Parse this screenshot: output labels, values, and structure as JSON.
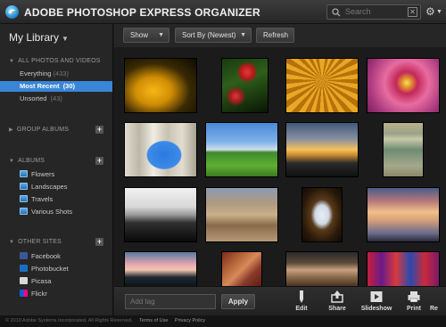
{
  "app": {
    "title": "ADOBE PHOTOSHOP EXPRESS ORGANIZER"
  },
  "search": {
    "placeholder": "Search"
  },
  "sidebar": {
    "title": "My Library",
    "section_all": "ALL PHOTOS AND VIDEOS",
    "items": [
      {
        "label": "Everything",
        "count": "(433)"
      },
      {
        "label": "Most Recent",
        "count": "(30)"
      },
      {
        "label": "Unsorted",
        "count": "(43)"
      }
    ],
    "section_group": "GROUP ALBUMS",
    "section_albums": "ALBUMS",
    "albums": [
      "Flowers",
      "Landscapes",
      "Travels",
      "Various Shots"
    ],
    "section_sites": "OTHER SITES",
    "sites": [
      "Facebook",
      "Photobucket",
      "Picasa",
      "Flickr"
    ]
  },
  "toolbar": {
    "show": "Show",
    "sort": "Sort By (Newest)",
    "refresh": "Refresh"
  },
  "bottom": {
    "tag_placeholder": "Add tag",
    "apply": "Apply",
    "actions": [
      "Edit",
      "Share",
      "Slideshow",
      "Print",
      "Re"
    ]
  },
  "footer": {
    "copyright": "© 2010 Adobe Systems Incorporated. All Rights Reserved.",
    "terms": "Terms of Use",
    "privacy": "Privacy Policy"
  },
  "colors": {
    "selection": "#3a85d6",
    "background": "#1b1b1b"
  }
}
